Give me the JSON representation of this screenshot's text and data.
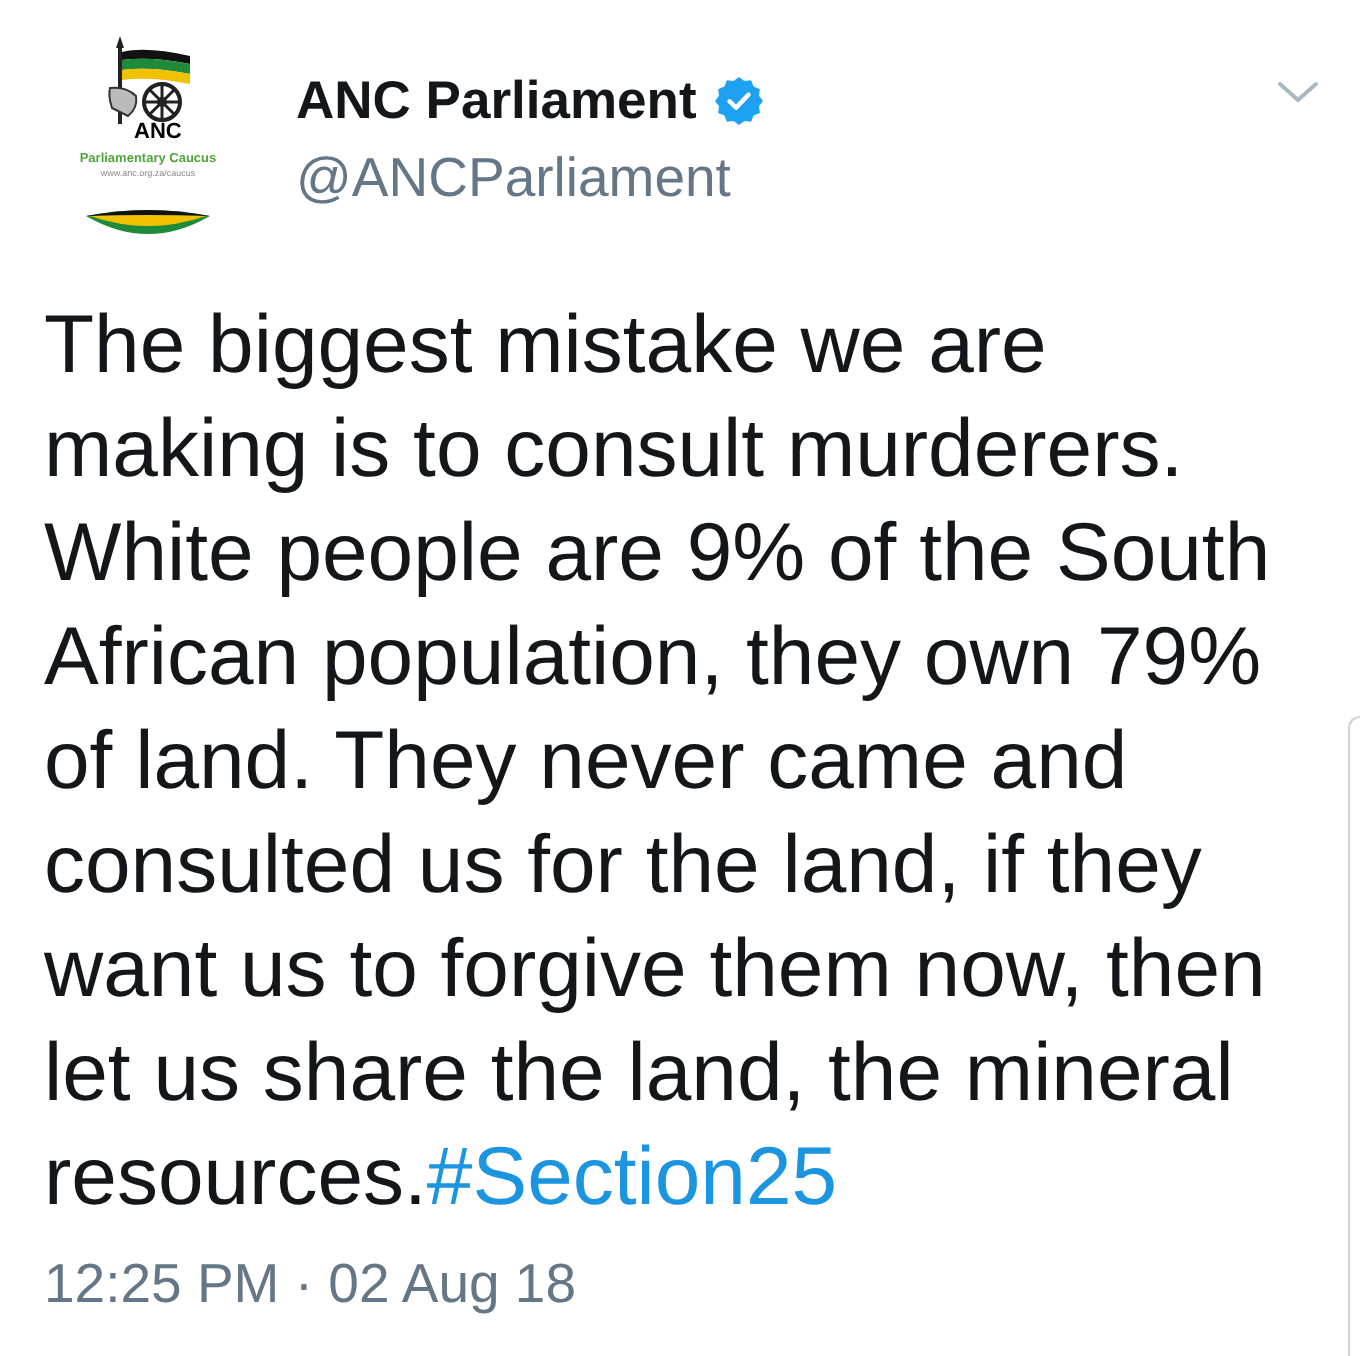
{
  "tweet": {
    "avatar": {
      "logo_text": "ANC",
      "caption": "Parliamentary Caucus",
      "url": "www.anc.org.za/caucus"
    },
    "author": {
      "name": "ANC Parliament",
      "verified": true,
      "handle": "@ANCParliament"
    },
    "text": "The biggest mistake we are making is to consult murderers. White people are 9% of the South African population, they own 79% of land. They never came and consulted us for the land, if they want us to forgive them now, then let us share the land, the mineral resources.",
    "hashtag": "#Section25",
    "timestamp": "12:25 PM · 02 Aug 18"
  }
}
